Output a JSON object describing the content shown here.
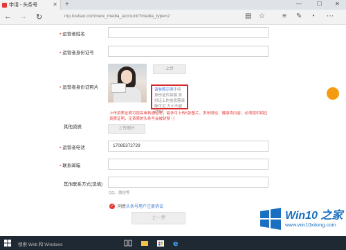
{
  "browser": {
    "tab_title": "申请 - 头条号",
    "tab_close": "✕",
    "new_tab": "+",
    "win_min": "—",
    "win_max": "☐",
    "url": "mp.toutiao.com/new_media_account/?media_type=2"
  },
  "form": {
    "operator_name_label": "运营者姓名",
    "operator_id_label": "运营者身份证号",
    "operator_id_photo_label": "运营者身份证照片",
    "upload_label": "上传",
    "example_link": "请参照示例",
    "example_text": "手持身份证件拍摄 身份证上的信息需清晰可见 大小不超过2M",
    "warning": "上传资质证明可提高审核通过率，最多可上传5张图片，发布财经、健康类内容，必须提供相应资质证明，无资质的头条号会被封禁 ⓘ",
    "other_qualifications_label": "其他资质",
    "upload_image_label": "上传图片",
    "phone_label": "运营者电话",
    "phone_value": "17085372729",
    "email_label": "联系邮箱",
    "other_contact_label": "其他联系方式(选填)",
    "other_contact_hint": "QQ、微信等",
    "agree_prefix": "同意",
    "agree_link": "头条号用户注册协议",
    "prev_button": "上一步"
  },
  "watermark": {
    "title": "Win10 之家",
    "url": "www.win10xitong.com"
  },
  "taskbar": {
    "search_placeholder": "搜索 Web 和 Windows"
  },
  "colors": {
    "accent": "#e53935",
    "link": "#3b7ad8",
    "win10_blue": "#1a6fc0",
    "taskbar": "#1f2933"
  }
}
